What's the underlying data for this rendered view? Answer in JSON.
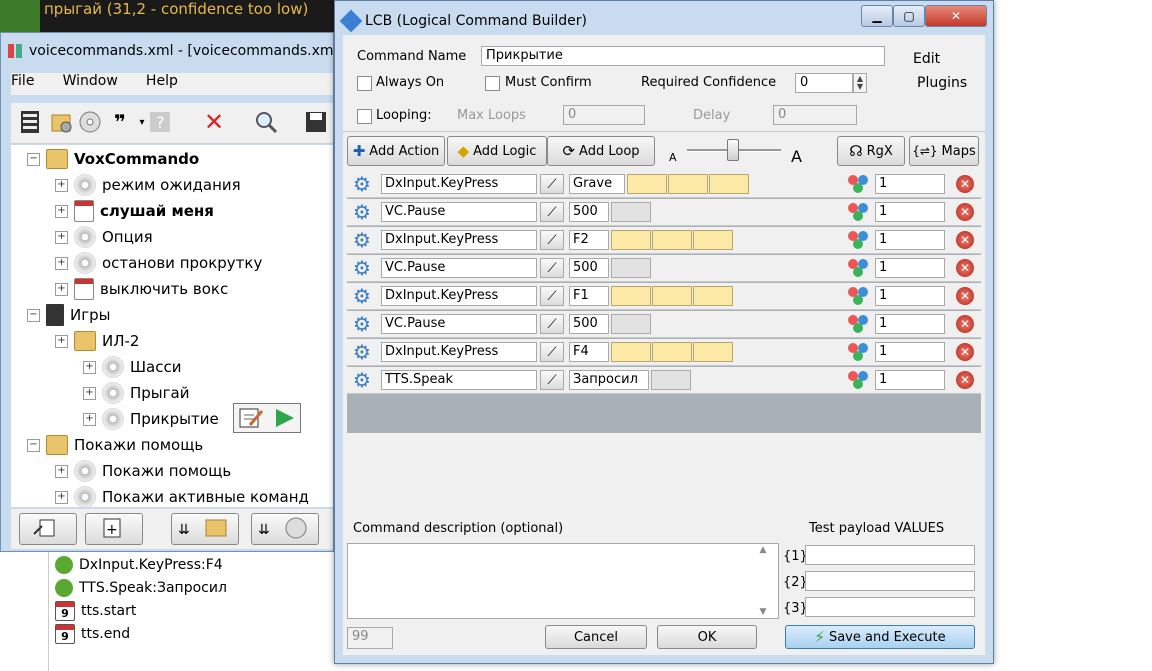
{
  "background": {
    "status_text": "прыгай (31,2 - confidence too low)"
  },
  "main_window": {
    "title": "voicecommands.xml - [voicecommands.xml]",
    "menu": [
      "File",
      "Window",
      "Help"
    ],
    "toolbar_quote": "❞",
    "tree": [
      {
        "label": "VoxCommando",
        "level": 0,
        "icon": "folder-gear-icon",
        "bold": true
      },
      {
        "label": "режим ожидания",
        "level": 1,
        "icon": "disc-icon"
      },
      {
        "label": "слушай меня",
        "level": 1,
        "icon": "calendar-icon",
        "bold": true
      },
      {
        "label": "Опция",
        "level": 1,
        "icon": "disc-icon"
      },
      {
        "label": "останови прокрутку",
        "level": 1,
        "icon": "disc-icon"
      },
      {
        "label": "выключить вокс",
        "level": 1,
        "icon": "calendar-icon"
      },
      {
        "label": "Игры",
        "level": 0,
        "icon": "book-icon"
      },
      {
        "label": "ИЛ-2",
        "level": 1,
        "icon": "folder-icon"
      },
      {
        "label": "Шасси",
        "level": 2,
        "icon": "disc-icon"
      },
      {
        "label": "Прыгай",
        "level": 2,
        "icon": "disc-icon"
      },
      {
        "label": "Прикрытие",
        "level": 2,
        "icon": "disc-icon"
      },
      {
        "label": "Покажи помощь",
        "level": 0,
        "icon": "folder-icon"
      },
      {
        "label": "Покажи помощь",
        "level": 1,
        "icon": "disc-icon"
      },
      {
        "label": "Покажи активные команд",
        "level": 1,
        "icon": "disc-icon"
      }
    ]
  },
  "log": [
    {
      "text": "DxInput.KeyPress:F4",
      "icon": "gear-icon"
    },
    {
      "text": "TTS.Speak:Запросил",
      "icon": "gear-icon"
    },
    {
      "text": "tts.start",
      "icon": "calendar-icon",
      "num": "9"
    },
    {
      "text": "tts.end",
      "icon": "calendar-icon",
      "num": "9"
    }
  ],
  "lcb": {
    "title": "LCB (Logical Command Builder)",
    "command_name_label": "Command Name",
    "command_name_value": "Прикрытие",
    "edit_label": "Edit",
    "plugins_label": "Plugins",
    "always_on_label": "Always On",
    "must_confirm_label": "Must Confirm",
    "required_confidence_label": "Required Confidence",
    "required_confidence_value": "0",
    "looping_label": "Looping:",
    "max_loops_label": "Max Loops",
    "max_loops_value": "0",
    "delay_label": "Delay",
    "delay_value": "0",
    "add_action_label": "Add Action",
    "add_logic_label": "Add Logic",
    "add_loop_label": "Add Loop",
    "font_small_label": "A",
    "font_large_label": "A",
    "rgx_label": "RgX",
    "maps_label": "Maps",
    "actions": [
      {
        "name": "DxInput.KeyPress",
        "param": "Grave",
        "param_cells": 3,
        "cell_style": "yellow",
        "count": "1"
      },
      {
        "name": "VC.Pause",
        "param": "500",
        "param_cells": 1,
        "cell_style": "grey",
        "count": "1"
      },
      {
        "name": "DxInput.KeyPress",
        "param": "F2",
        "param_cells": 3,
        "cell_style": "yellow",
        "count": "1"
      },
      {
        "name": "VC.Pause",
        "param": "500",
        "param_cells": 1,
        "cell_style": "grey",
        "count": "1"
      },
      {
        "name": "DxInput.KeyPress",
        "param": "F1",
        "param_cells": 3,
        "cell_style": "yellow",
        "count": "1"
      },
      {
        "name": "VC.Pause",
        "param": "500",
        "param_cells": 1,
        "cell_style": "grey",
        "count": "1"
      },
      {
        "name": "DxInput.KeyPress",
        "param": "F4",
        "param_cells": 3,
        "cell_style": "yellow",
        "count": "1"
      },
      {
        "name": "TTS.Speak",
        "param": "Запросил",
        "param_cells": 1,
        "cell_style": "grey",
        "count": "1"
      }
    ],
    "description_label": "Command description (optional)",
    "test_payload_label": "Test payload VALUES",
    "payload_labels": [
      "{1}",
      "{2}",
      "{3}"
    ],
    "payload_values": [
      "",
      "",
      ""
    ],
    "char_count": "99",
    "cancel_label": "Cancel",
    "ok_label": "OK",
    "save_execute_label": "Save and Execute"
  },
  "colors": {
    "window_frame": "#c9dcef",
    "param_yellow": "#fde9a6",
    "delete_red": "#c2392a",
    "gear_blue": "#3b7cc4"
  }
}
